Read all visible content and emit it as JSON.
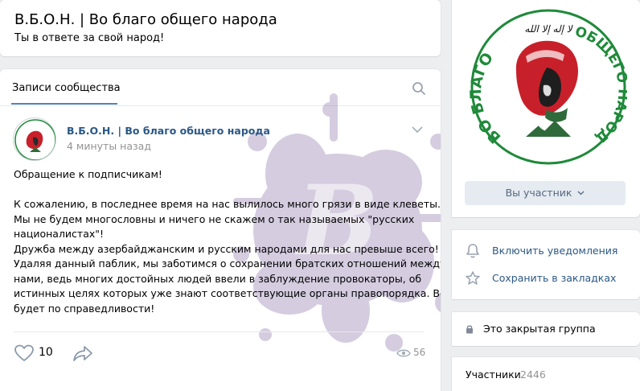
{
  "group": {
    "name": "В.Б.О.Н. | Во благо общего народа",
    "status": "Ты в ответе за свой народ!"
  },
  "wall": {
    "tab_label": "Записи сообщества"
  },
  "post": {
    "author": "В.Б.О.Н. | Во благо общего народа",
    "time": "4 минуты назад",
    "lines": [
      "Обращение к подписчикам!",
      "",
      "К сожалению, в последнее время на нас вылилось много грязи в виде клеветы.",
      "Мы не будем многословны и ничего не скажем о так называемых \"русских",
      "националистах\"!",
      "Дружба между азербайджанским и русским народами для нас превыше всего!",
      "Удаляя данный паблик, мы заботимся о сохранении братских отношений между",
      "нами, ведь многих достойных людей ввели в заблуждение провокаторы, об",
      "истинных целях которых уже знают соответствующие органы правопорядка. Всё",
      "будет по справедливости!"
    ],
    "likes": "10",
    "views": "56"
  },
  "sidebar": {
    "logo_text_left": "ВО БЛАГО",
    "logo_text_right": "ОБЩЕГО НАРОДА",
    "member_button": "Вы участник",
    "actions": [
      {
        "label": "Включить уведомления",
        "icon": "bell-icon"
      },
      {
        "label": "Сохранить в закладках",
        "icon": "bookmark-star-icon"
      }
    ],
    "closed_label": "Это закрытая группа",
    "members_label": "Участники",
    "members_count": "2446"
  },
  "colors": {
    "background": "#edeef0",
    "link": "#2a5885",
    "accent": "#5181b8",
    "muted": "#939393",
    "logo_green": "#1f8a3a",
    "logo_red": "#c8202a"
  }
}
